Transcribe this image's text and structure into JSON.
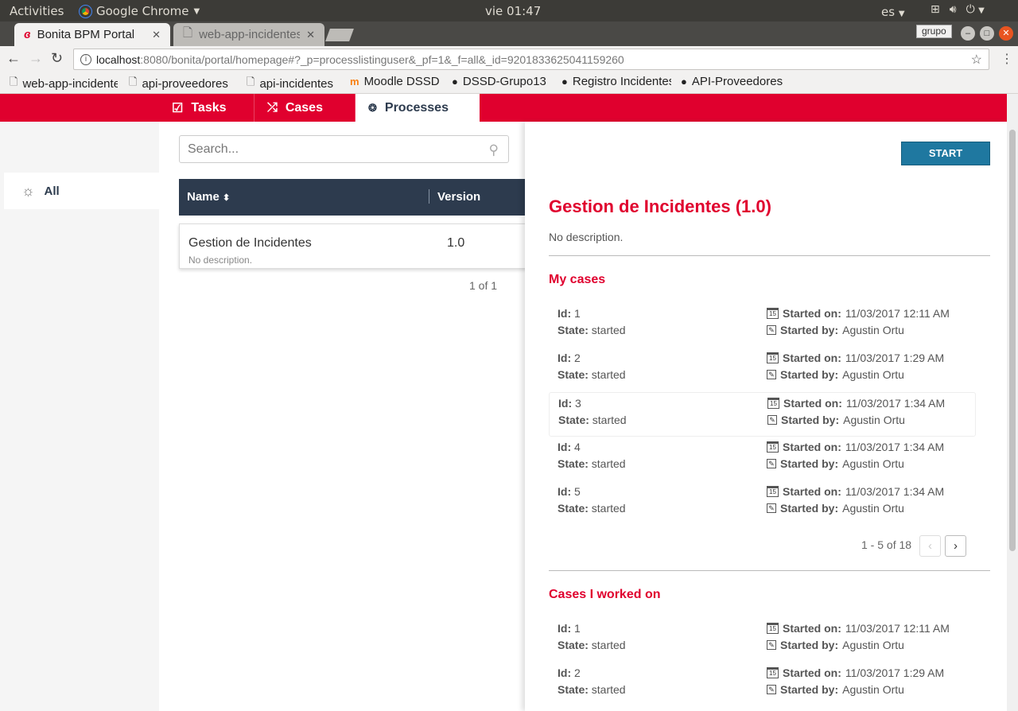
{
  "os_bar": {
    "activities": "Activities",
    "app_name": "Google Chrome",
    "clock": "vie 01:47",
    "language": "es"
  },
  "browser": {
    "tabs": [
      {
        "title": "Bonita BPM Portal"
      },
      {
        "title": "web-app-incidentes"
      }
    ],
    "profile": "grupo",
    "url_host": "localhost",
    "url_path": ":8080/bonita/portal/homepage#?_p=processlistinguser&_pf=1&_f=all&_id=9201833625041159260",
    "bookmarks": [
      {
        "label": "web-app-incidentes"
      },
      {
        "label": "api-proveedores"
      },
      {
        "label": "api-incidentes"
      },
      {
        "label": "Moodle DSSD"
      },
      {
        "label": "DSSD-Grupo13"
      },
      {
        "label": "Registro Incidentes"
      },
      {
        "label": "API-Proveedores"
      }
    ]
  },
  "nav": {
    "tasks": "Tasks",
    "cases": "Cases",
    "processes": "Processes"
  },
  "filter": {
    "all": "All"
  },
  "search": {
    "placeholder": "Search..."
  },
  "table": {
    "col_name": "Name",
    "col_version": "Version",
    "rows": [
      {
        "name": "Gestion de Incidentes",
        "description": "No description.",
        "version": "1.0"
      }
    ],
    "pager": "1 of 1"
  },
  "detail": {
    "start_label": "START",
    "title": "Gestion de Incidentes (1.0)",
    "description": "No description.",
    "my_cases_title": "My cases",
    "labels": {
      "id": "Id:",
      "state": "State:",
      "started_on": "Started on:",
      "started_by": "Started by:"
    },
    "my_cases": [
      {
        "id": "1",
        "state": "started",
        "started_on": "11/03/2017 12:11 AM",
        "started_by": "Agustin Ortu"
      },
      {
        "id": "2",
        "state": "started",
        "started_on": "11/03/2017 1:29 AM",
        "started_by": "Agustin Ortu"
      },
      {
        "id": "3",
        "state": "started",
        "started_on": "11/03/2017 1:34 AM",
        "started_by": "Agustin Ortu"
      },
      {
        "id": "4",
        "state": "started",
        "started_on": "11/03/2017 1:34 AM",
        "started_by": "Agustin Ortu"
      },
      {
        "id": "5",
        "state": "started",
        "started_on": "11/03/2017 1:34 AM",
        "started_by": "Agustin Ortu"
      }
    ],
    "my_cases_pager": "1 - 5 of 18",
    "worked_title": "Cases I worked on",
    "worked_cases": [
      {
        "id": "1",
        "state": "started",
        "started_on": "11/03/2017 12:11 AM",
        "started_by": "Agustin Ortu"
      },
      {
        "id": "2",
        "state": "started",
        "started_on": "11/03/2017 1:29 AM",
        "started_by": "Agustin Ortu"
      }
    ]
  },
  "colors": {
    "brand_red": "#e0002e",
    "navy": "#2d3b4e",
    "start_blue": "#1f78a0"
  }
}
